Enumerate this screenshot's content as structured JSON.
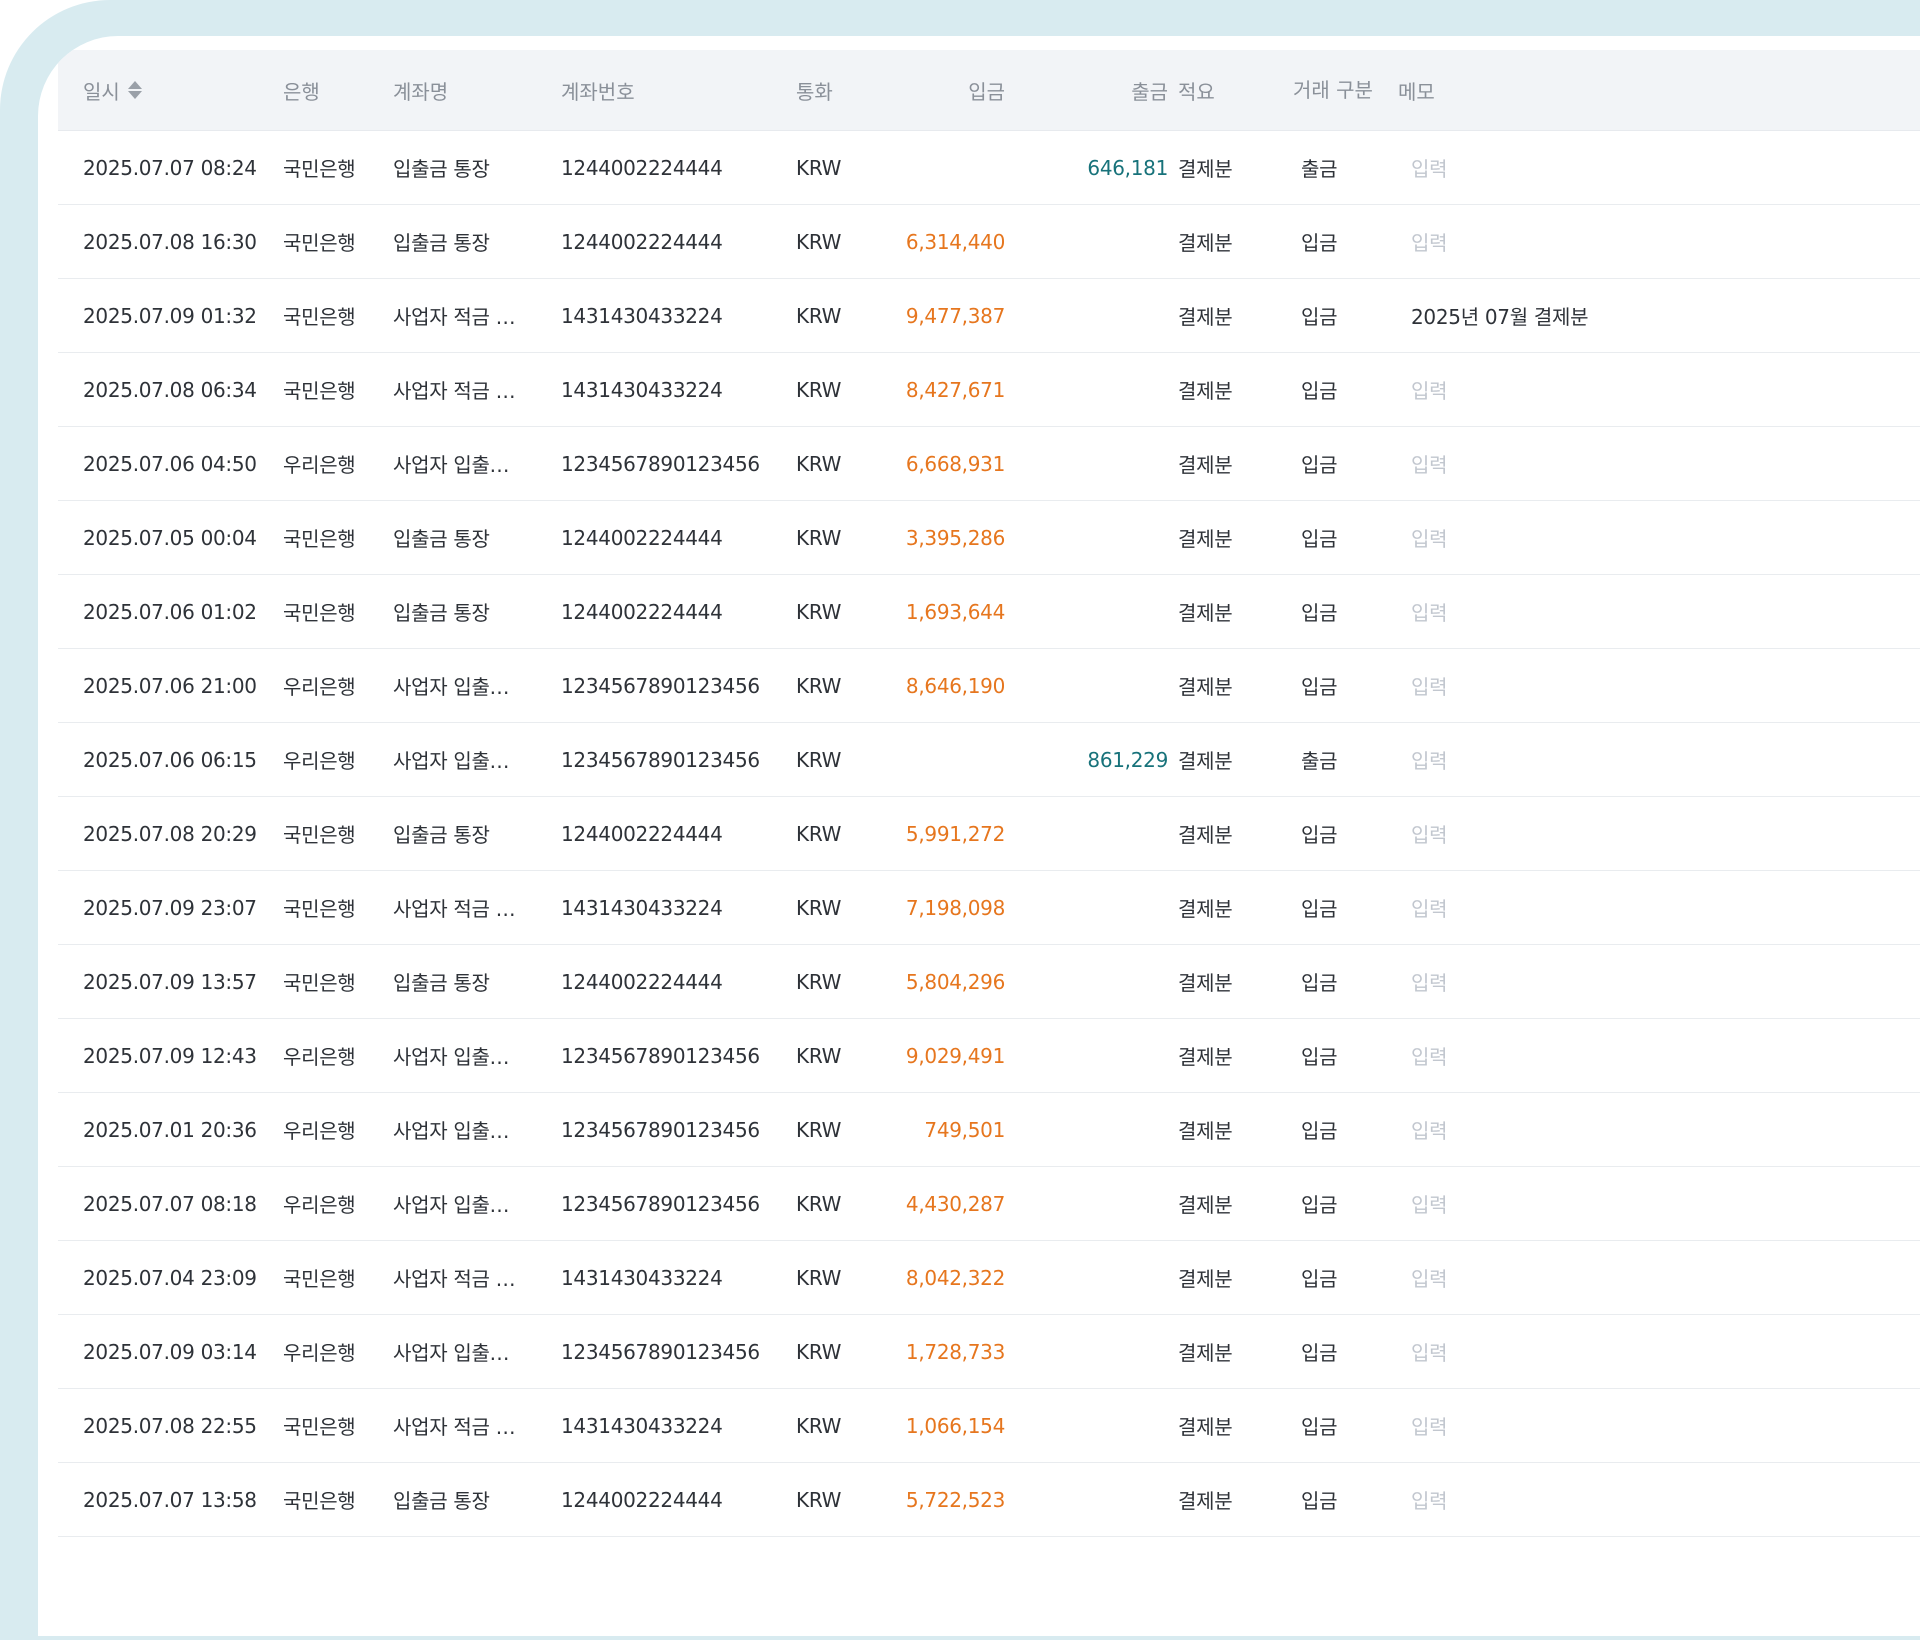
{
  "header": {
    "date": "일시",
    "bank": "은행",
    "account_name": "계좌명",
    "account_no": "계좌번호",
    "currency": "통화",
    "deposit": "입금",
    "withdraw": "출금",
    "summary": "적요",
    "type": "거래 구분",
    "memo": "메모"
  },
  "rows": [
    {
      "date": "2025.07.07 08:24",
      "bank": "국민은행",
      "account_name": "입출금 통장",
      "account_no": "1244002224444",
      "currency": "KRW",
      "deposit": "",
      "withdraw": "646,181",
      "summary": "결제분",
      "type": "출금",
      "memo": "입력"
    },
    {
      "date": "2025.07.08 16:30",
      "bank": "국민은행",
      "account_name": "입출금 통장",
      "account_no": "1244002224444",
      "currency": "KRW",
      "deposit": "6,314,440",
      "withdraw": "",
      "summary": "결제분",
      "type": "입금",
      "memo": "입력"
    },
    {
      "date": "2025.07.09 01:32",
      "bank": "국민은행",
      "account_name": "사업자 적금 …",
      "account_no": "1431430433224",
      "currency": "KRW",
      "deposit": "9,477,387",
      "withdraw": "",
      "summary": "결제분",
      "type": "입금",
      "memo": "2025년 07월 결제분"
    },
    {
      "date": "2025.07.08 06:34",
      "bank": "국민은행",
      "account_name": "사업자 적금 …",
      "account_no": "1431430433224",
      "currency": "KRW",
      "deposit": "8,427,671",
      "withdraw": "",
      "summary": "결제분",
      "type": "입금",
      "memo": "입력"
    },
    {
      "date": "2025.07.06 04:50",
      "bank": "우리은행",
      "account_name": "사업자 입출…",
      "account_no": "1234567890123456",
      "currency": "KRW",
      "deposit": "6,668,931",
      "withdraw": "",
      "summary": "결제분",
      "type": "입금",
      "memo": "입력"
    },
    {
      "date": "2025.07.05 00:04",
      "bank": "국민은행",
      "account_name": "입출금 통장",
      "account_no": "1244002224444",
      "currency": "KRW",
      "deposit": "3,395,286",
      "withdraw": "",
      "summary": "결제분",
      "type": "입금",
      "memo": "입력"
    },
    {
      "date": "2025.07.06 01:02",
      "bank": "국민은행",
      "account_name": "입출금 통장",
      "account_no": "1244002224444",
      "currency": "KRW",
      "deposit": "1,693,644",
      "withdraw": "",
      "summary": "결제분",
      "type": "입금",
      "memo": "입력"
    },
    {
      "date": "2025.07.06 21:00",
      "bank": "우리은행",
      "account_name": "사업자 입출…",
      "account_no": "1234567890123456",
      "currency": "KRW",
      "deposit": "8,646,190",
      "withdraw": "",
      "summary": "결제분",
      "type": "입금",
      "memo": "입력"
    },
    {
      "date": "2025.07.06 06:15",
      "bank": "우리은행",
      "account_name": "사업자 입출…",
      "account_no": "1234567890123456",
      "currency": "KRW",
      "deposit": "",
      "withdraw": "861,229",
      "summary": "결제분",
      "type": "출금",
      "memo": "입력"
    },
    {
      "date": "2025.07.08 20:29",
      "bank": "국민은행",
      "account_name": "입출금 통장",
      "account_no": "1244002224444",
      "currency": "KRW",
      "deposit": "5,991,272",
      "withdraw": "",
      "summary": "결제분",
      "type": "입금",
      "memo": "입력"
    },
    {
      "date": "2025.07.09 23:07",
      "bank": "국민은행",
      "account_name": "사업자 적금 …",
      "account_no": "1431430433224",
      "currency": "KRW",
      "deposit": "7,198,098",
      "withdraw": "",
      "summary": "결제분",
      "type": "입금",
      "memo": "입력"
    },
    {
      "date": "2025.07.09 13:57",
      "bank": "국민은행",
      "account_name": "입출금 통장",
      "account_no": "1244002224444",
      "currency": "KRW",
      "deposit": "5,804,296",
      "withdraw": "",
      "summary": "결제분",
      "type": "입금",
      "memo": "입력"
    },
    {
      "date": "2025.07.09 12:43",
      "bank": "우리은행",
      "account_name": "사업자 입출…",
      "account_no": "1234567890123456",
      "currency": "KRW",
      "deposit": "9,029,491",
      "withdraw": "",
      "summary": "결제분",
      "type": "입금",
      "memo": "입력"
    },
    {
      "date": "2025.07.01 20:36",
      "bank": "우리은행",
      "account_name": "사업자 입출…",
      "account_no": "1234567890123456",
      "currency": "KRW",
      "deposit": "749,501",
      "withdraw": "",
      "summary": "결제분",
      "type": "입금",
      "memo": "입력"
    },
    {
      "date": "2025.07.07 08:18",
      "bank": "우리은행",
      "account_name": "사업자 입출…",
      "account_no": "1234567890123456",
      "currency": "KRW",
      "deposit": "4,430,287",
      "withdraw": "",
      "summary": "결제분",
      "type": "입금",
      "memo": "입력"
    },
    {
      "date": "2025.07.04 23:09",
      "bank": "국민은행",
      "account_name": "사업자 적금 …",
      "account_no": "1431430433224",
      "currency": "KRW",
      "deposit": "8,042,322",
      "withdraw": "",
      "summary": "결제분",
      "type": "입금",
      "memo": "입력"
    },
    {
      "date": "2025.07.09 03:14",
      "bank": "우리은행",
      "account_name": "사업자 입출…",
      "account_no": "1234567890123456",
      "currency": "KRW",
      "deposit": "1,728,733",
      "withdraw": "",
      "summary": "결제분",
      "type": "입금",
      "memo": "입력"
    },
    {
      "date": "2025.07.08 22:55",
      "bank": "국민은행",
      "account_name": "사업자 적금 …",
      "account_no": "1431430433224",
      "currency": "KRW",
      "deposit": "1,066,154",
      "withdraw": "",
      "summary": "결제분",
      "type": "입금",
      "memo": "입력"
    },
    {
      "date": "2025.07.07 13:58",
      "bank": "국민은행",
      "account_name": "입출금 통장",
      "account_no": "1244002224444",
      "currency": "KRW",
      "deposit": "5,722,523",
      "withdraw": "",
      "summary": "결제분",
      "type": "입금",
      "memo": "입력"
    }
  ],
  "colors": {
    "deposit": "#e6761e",
    "withdraw": "#17727a",
    "memo_placeholder": "#c2c7cf",
    "frame": "#d8ebf0",
    "header_bg": "#f2f4f7"
  }
}
